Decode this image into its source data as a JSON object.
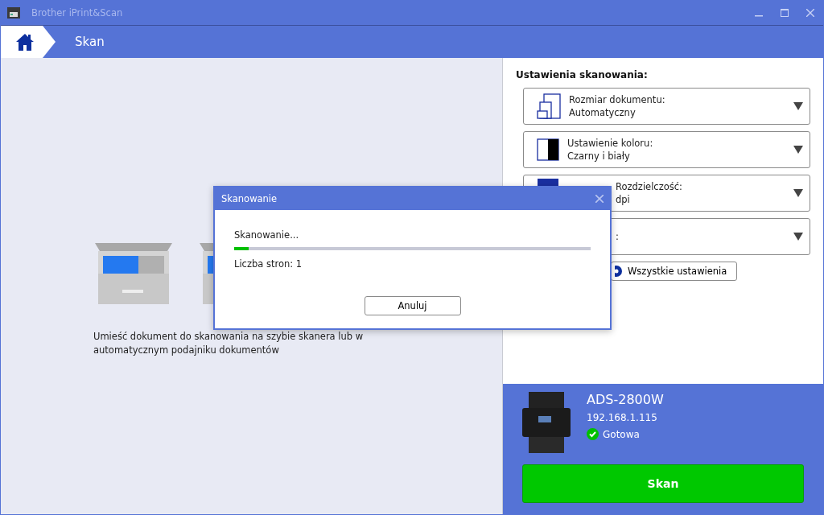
{
  "window": {
    "title": "Brother iPrint&Scan"
  },
  "nav": {
    "title": "Skan"
  },
  "main": {
    "instruction": "Umieść dokument do skanowania na szybie skanera lub w automatycznym podajniku dokumentów"
  },
  "settings": {
    "heading": "Ustawienia skanowania:",
    "items": [
      {
        "kind": "size",
        "label": "Rozmiar dokumentu:",
        "value": "Automatyczny"
      },
      {
        "kind": "color",
        "label": "Ustawienie koloru:",
        "value": "Czarny i biały"
      },
      {
        "kind": "resolution",
        "label": "Rozdzielczość:",
        "value": "dpi",
        "covered": true
      },
      {
        "kind": "other",
        "label": ":",
        "covered": true
      }
    ],
    "all_button": "Wszystkie ustawienia"
  },
  "device": {
    "model": "ADS-2800W",
    "ip": "192.168.1.115",
    "status": "Gotowa",
    "ready": true,
    "scan_button": "Skan"
  },
  "dialog": {
    "title": "Skanowanie",
    "message": "Skanowanie...",
    "level": 0.04,
    "pages": "Liczba stron: 1",
    "cancel": "Anuluj"
  }
}
